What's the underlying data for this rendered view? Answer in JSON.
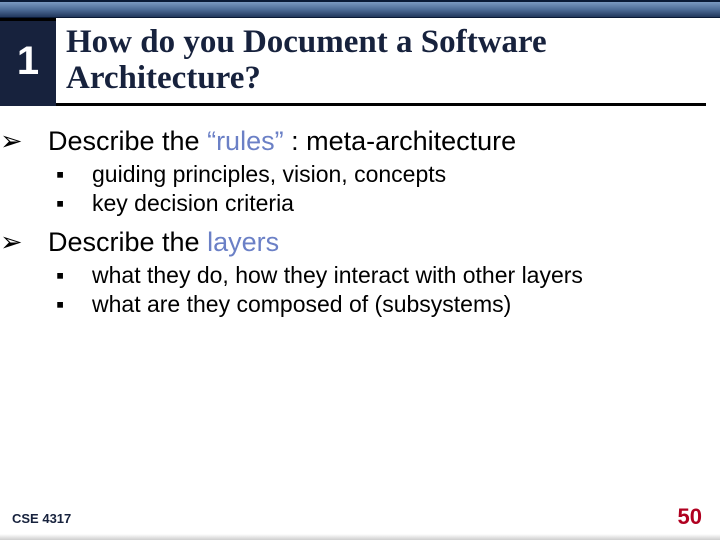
{
  "slide": {
    "number": "1",
    "title": "How do you Document a Software Architecture?"
  },
  "bullets": [
    {
      "prefix": "Describe the ",
      "highlight": "“rules”",
      "suffix": " :  meta-architecture",
      "children": [
        "guiding principles, vision, concepts",
        "key decision criteria"
      ]
    },
    {
      "prefix": "Describe the ",
      "highlight": "layers",
      "suffix": "",
      "children": [
        "what they do, how they interact with other layers",
        "what are they composed of (subsystems)"
      ]
    }
  ],
  "footer": {
    "course": "CSE 4317",
    "page": "50"
  },
  "glyphs": {
    "arrow": "➢",
    "square": "▪"
  }
}
